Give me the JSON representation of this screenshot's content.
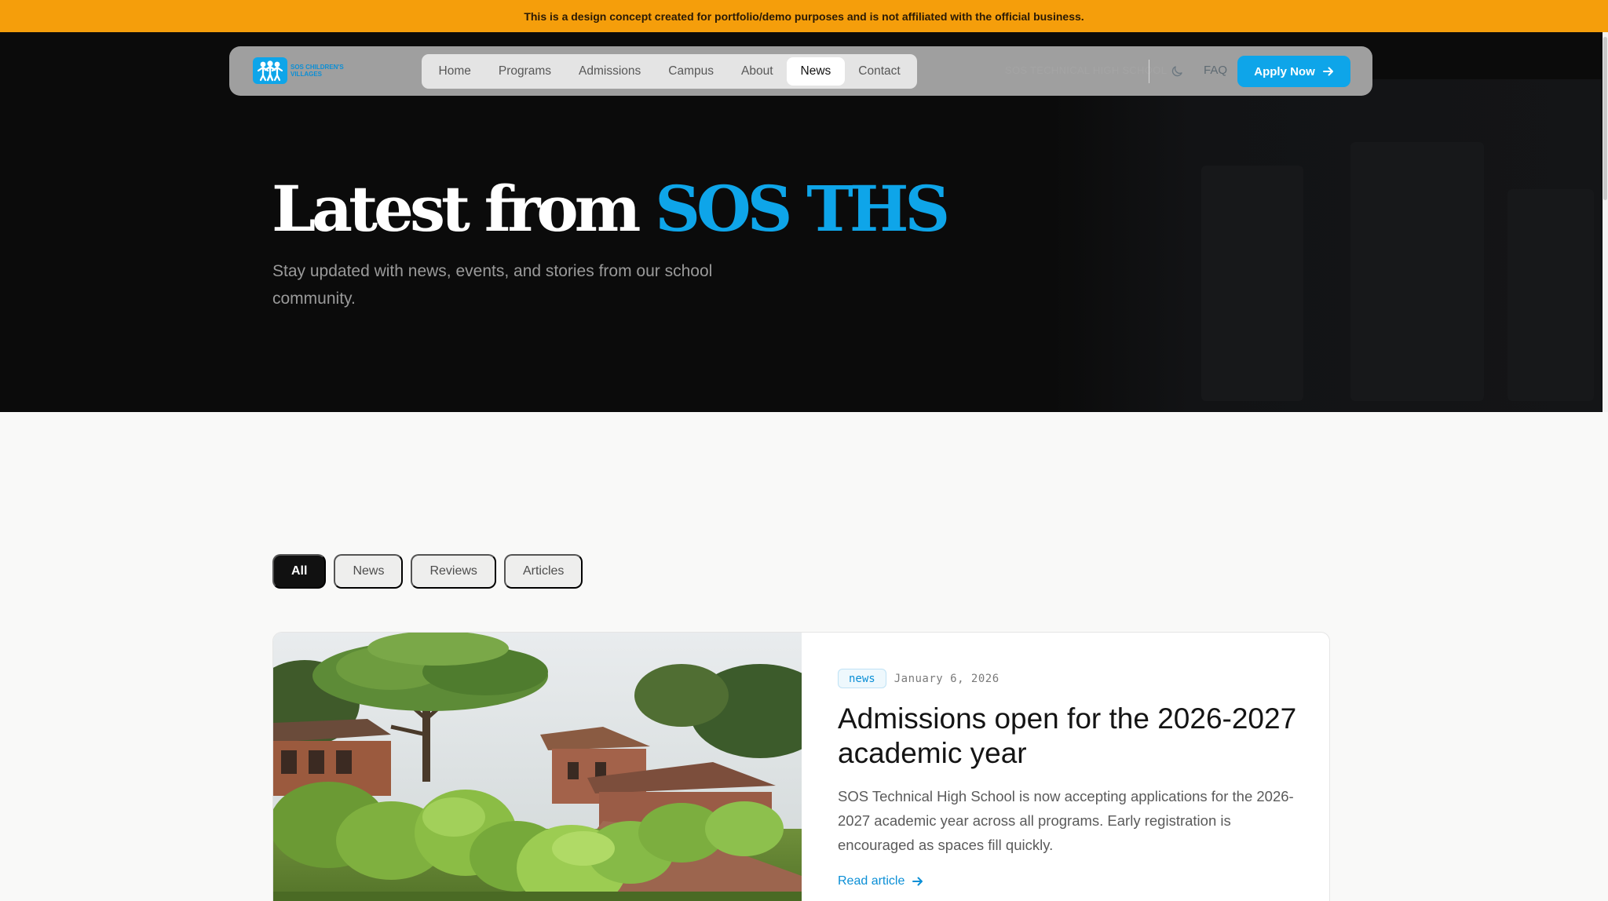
{
  "banner": {
    "text": "This is a design concept created for portfolio/demo purposes and is not affiliated with the official business."
  },
  "brand": {
    "logo_text": "SOS CHILDREN'S VILLAGES",
    "accent_color": "#0ea5e9",
    "banner_color": "#f59e0b"
  },
  "nav": {
    "items": [
      {
        "label": "Home",
        "active": false
      },
      {
        "label": "Programs",
        "active": false
      },
      {
        "label": "Admissions",
        "active": false
      },
      {
        "label": "Campus",
        "active": false
      },
      {
        "label": "About",
        "active": false
      },
      {
        "label": "News",
        "active": true
      },
      {
        "label": "Contact",
        "active": false
      }
    ],
    "faded_text": "SOS TECHNICAL HIGH SCHOOL",
    "theme_icon": "moon-icon",
    "faq_label": "FAQ",
    "apply_label": "Apply Now",
    "apply_icon": "arrow-right-icon"
  },
  "hero": {
    "title_main": "Latest from",
    "title_accent": "SOS THS",
    "subtitle": "Stay updated with news, events, and stories from our school community."
  },
  "filters": [
    {
      "label": "All",
      "active": true
    },
    {
      "label": "News",
      "active": false
    },
    {
      "label": "Reviews",
      "active": false
    },
    {
      "label": "Articles",
      "active": false
    }
  ],
  "featured": {
    "tag": "news",
    "date": "January 6, 2026",
    "title": "Admissions open for the 2026-2027 academic year",
    "excerpt": "SOS Technical High School is now accepting applications for the 2026-2027 academic year across all programs. Early registration is encouraged as spaces fill quickly.",
    "read_label": "Read article",
    "image": "campus-buildings-photo"
  }
}
